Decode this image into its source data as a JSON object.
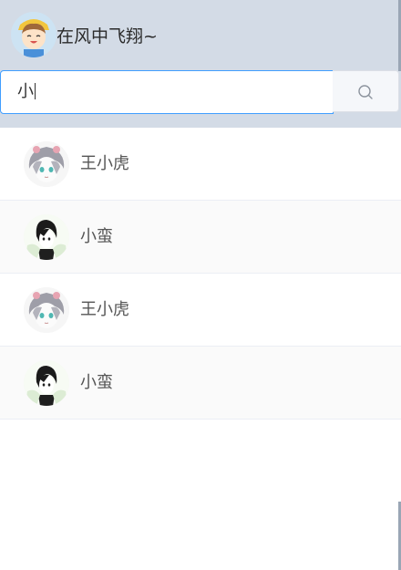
{
  "user": {
    "name": "在风中飞翔~",
    "avatar_icon": "user-avatar-cartoon-girl-icon"
  },
  "search": {
    "value": "小",
    "button_icon": "search-icon"
  },
  "contacts": [
    {
      "name": "王小虎",
      "avatar_icon": "contact-avatar-grey-hair-icon"
    },
    {
      "name": "小蛮",
      "avatar_icon": "contact-avatar-black-hair-icon"
    },
    {
      "name": "王小虎",
      "avatar_icon": "contact-avatar-grey-hair-icon"
    },
    {
      "name": "小蛮",
      "avatar_icon": "contact-avatar-black-hair-icon"
    }
  ],
  "colors": {
    "header_bg": "#d3dbe6",
    "accent": "#409eff",
    "row_alt_bg": "#fafafa"
  }
}
